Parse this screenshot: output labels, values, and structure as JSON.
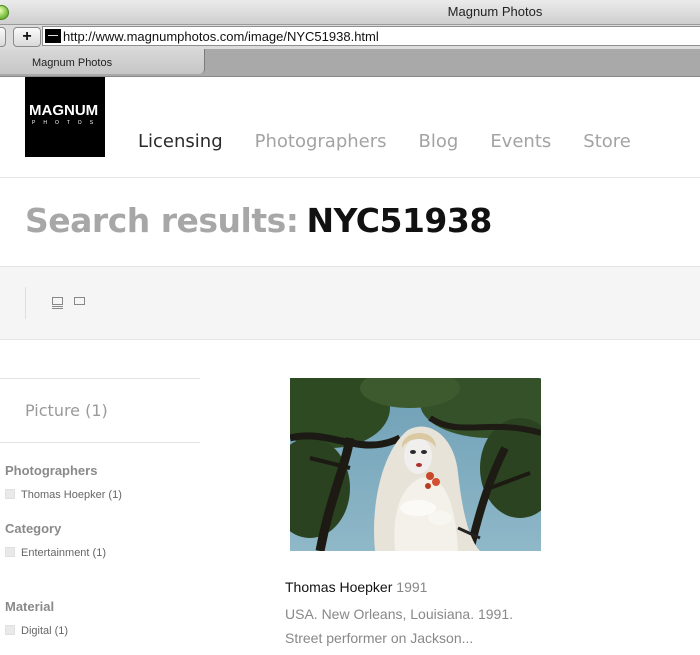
{
  "browser": {
    "window_title": "Magnum Photos",
    "add_label": "+",
    "url": "http://www.magnumphotos.com/image/NYC51938.html",
    "tab_title": "Magnum Photos"
  },
  "site": {
    "logo_main": "MAGNUM",
    "logo_sub": "PHOTOS",
    "nav": [
      {
        "label": "Licensing",
        "active": true
      },
      {
        "label": "Photographers",
        "active": false
      },
      {
        "label": "Blog",
        "active": false
      },
      {
        "label": "Events",
        "active": false
      },
      {
        "label": "Store",
        "active": false
      }
    ]
  },
  "search": {
    "label": "Search results:",
    "query": "NYC51938"
  },
  "sidebar": {
    "picture_count": "Picture (1)",
    "facets": [
      {
        "title": "Photographers",
        "items": [
          "Thomas Hoepker (1)"
        ]
      },
      {
        "title": "Category",
        "items": [
          "Entertainment (1)"
        ]
      },
      {
        "title": "Material",
        "items": [
          "Digital (1)"
        ]
      }
    ]
  },
  "result": {
    "photographer": "Thomas Hoepker",
    "year": "1991",
    "caption_line1": "USA. New Orleans, Louisiana. 1991.",
    "caption_line2": "Street performer on Jackson..."
  },
  "colors": {
    "nav_active": "#2a2a2a",
    "nav_inactive": "#a3a3a3",
    "heading_gray": "#a7a7a7"
  }
}
